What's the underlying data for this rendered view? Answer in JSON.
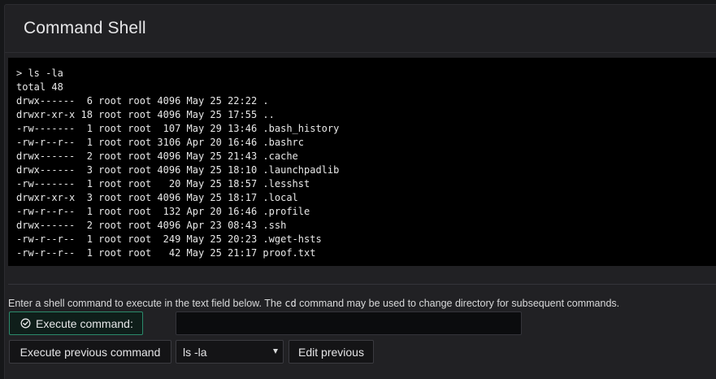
{
  "panel": {
    "title": "Command Shell"
  },
  "terminal": {
    "lines": [
      "> ls -la",
      "total 48",
      "drwx------  6 root root 4096 May 25 22:22 .",
      "drwxr-xr-x 18 root root 4096 May 25 17:55 ..",
      "-rw-------  1 root root  107 May 29 13:46 .bash_history",
      "-rw-r--r--  1 root root 3106 Apr 20 16:46 .bashrc",
      "drwx------  2 root root 4096 May 25 21:43 .cache",
      "drwx------  3 root root 4096 May 25 18:10 .launchpadlib",
      "-rw-------  1 root root   20 May 25 18:57 .lesshst",
      "drwxr-xr-x  3 root root 4096 May 25 18:17 .local",
      "-rw-r--r--  1 root root  132 Apr 20 16:46 .profile",
      "drwx------  2 root root 4096 Apr 23 08:43 .ssh",
      "-rw-r--r--  1 root root  249 May 25 20:23 .wget-hsts",
      "-rw-r--r--  1 root root   42 May 25 21:17 proof.txt"
    ]
  },
  "help": {
    "before": "Enter a shell command to execute in the text field below. The ",
    "code": "cd",
    "after": " command may be used to change directory for subsequent commands."
  },
  "controls": {
    "execute_label": "Execute command:",
    "execute_icon": "check-circle-icon",
    "command_value": "",
    "command_placeholder": "",
    "previous_label": "Execute previous command",
    "history_selected": "ls -la",
    "edit_label": "Edit previous"
  },
  "colors": {
    "background": "#161719",
    "panel": "#212124",
    "terminal_bg": "#000000",
    "accent_green": "#2b8a6b"
  }
}
